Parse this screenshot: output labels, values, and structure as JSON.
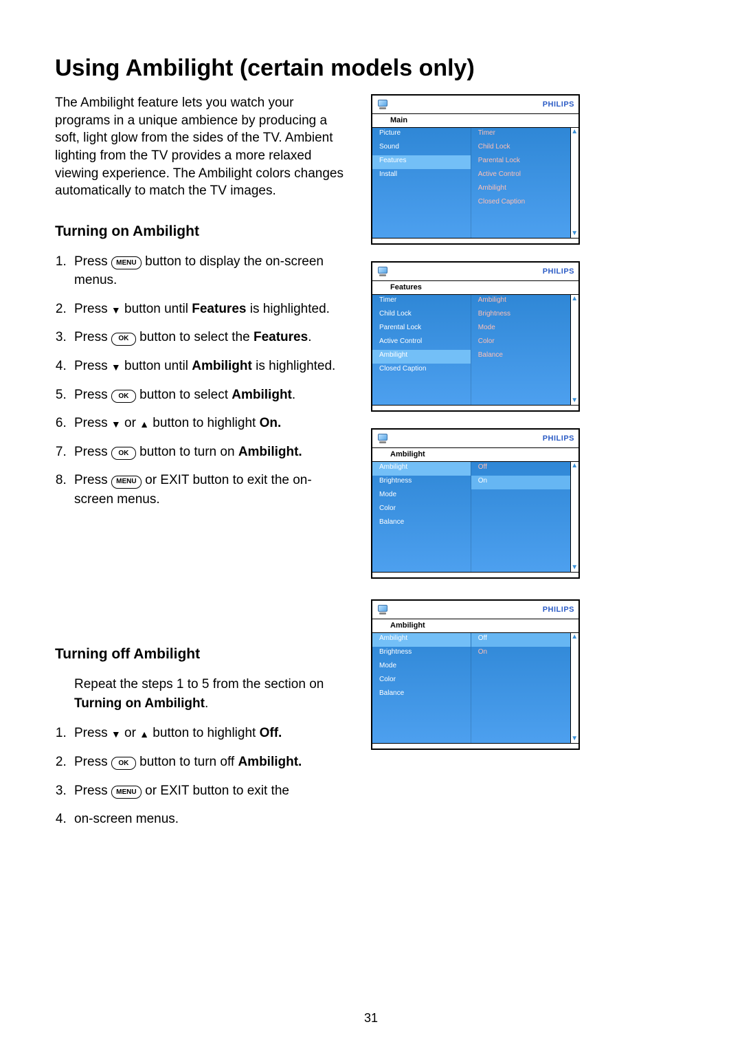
{
  "page_number": "31",
  "title": "Using Ambilight (certain models only)",
  "intro": "The Ambilight feature lets you watch your programs in a unique ambience by producing a soft, light glow from the sides of the TV. Ambient lighting from the TV provides a more relaxed viewing experience. The Ambilight colors changes automatically to match the TV images.",
  "on": {
    "heading": "Turning on Ambilight",
    "s1a": "Press ",
    "s1b": " button to display the on-screen menus.",
    "s2a": "Press ",
    "s2b": " button until ",
    "s2c": "Features",
    "s2d": " is highlighted.",
    "s3a": "Press ",
    "s3b": " button to select the ",
    "s3c": "Features",
    "s3d": ".",
    "s4a": "Press ",
    "s4b": " button until ",
    "s4c": "Ambilight",
    "s4d": " is highlighted.",
    "s5a": "Press ",
    "s5b": " button to select ",
    "s5c": "Ambilight",
    "s5d": ".",
    "s6a": "Press ",
    "s6b": " or ",
    "s6c": " button to highlight ",
    "s6d": "On.",
    "s7a": "Press ",
    "s7b": " button to turn on ",
    "s7c": "Ambilight.",
    "s8a": "Press ",
    "s8b": " or EXIT button to exit the on-screen menus."
  },
  "off": {
    "heading": "Turning off Ambilight",
    "note_a": "Repeat the steps 1 to 5 from the section on ",
    "note_b": "Turning on Ambilight",
    "note_c": ".",
    "s1a": "Press ",
    "s1b": " or ",
    "s1c": " button to highlight ",
    "s1d": "Off.",
    "s2a": "Press ",
    "s2b": " button to turn off ",
    "s2c": "Ambilight.",
    "s3a": "Press ",
    "s3b": " or EXIT button to exit the",
    "s4": "on-screen menus."
  },
  "btns": {
    "menu": "MENU",
    "ok": "OK"
  },
  "brand": "PHILIPS",
  "menus": {
    "m1": {
      "crumb": "Main",
      "left": [
        "Picture",
        "Sound",
        "Features",
        "Install"
      ],
      "sel": 2,
      "right": [
        "Timer",
        "Child Lock",
        "Parental Lock",
        "Active Control",
        "Ambilight",
        "Closed Caption"
      ]
    },
    "m2": {
      "crumb": "Features",
      "left": [
        "Timer",
        "Child Lock",
        "Parental Lock",
        "Active Control",
        "Ambilight",
        "Closed Caption"
      ],
      "sel": 4,
      "right": [
        "Ambilight",
        "Brightness",
        "Mode",
        "Color",
        "Balance"
      ]
    },
    "m3": {
      "crumb": "Ambilight",
      "left": [
        "Ambilight",
        "Brightness",
        "Mode",
        "Color",
        "Balance"
      ],
      "sel": 0,
      "right": [
        "Off",
        "On"
      ],
      "hl": 1
    },
    "m4": {
      "crumb": "Ambilight",
      "left": [
        "Ambilight",
        "Brightness",
        "Mode",
        "Color",
        "Balance"
      ],
      "sel": 0,
      "right": [
        "Off",
        "On"
      ],
      "hl": 0
    }
  }
}
